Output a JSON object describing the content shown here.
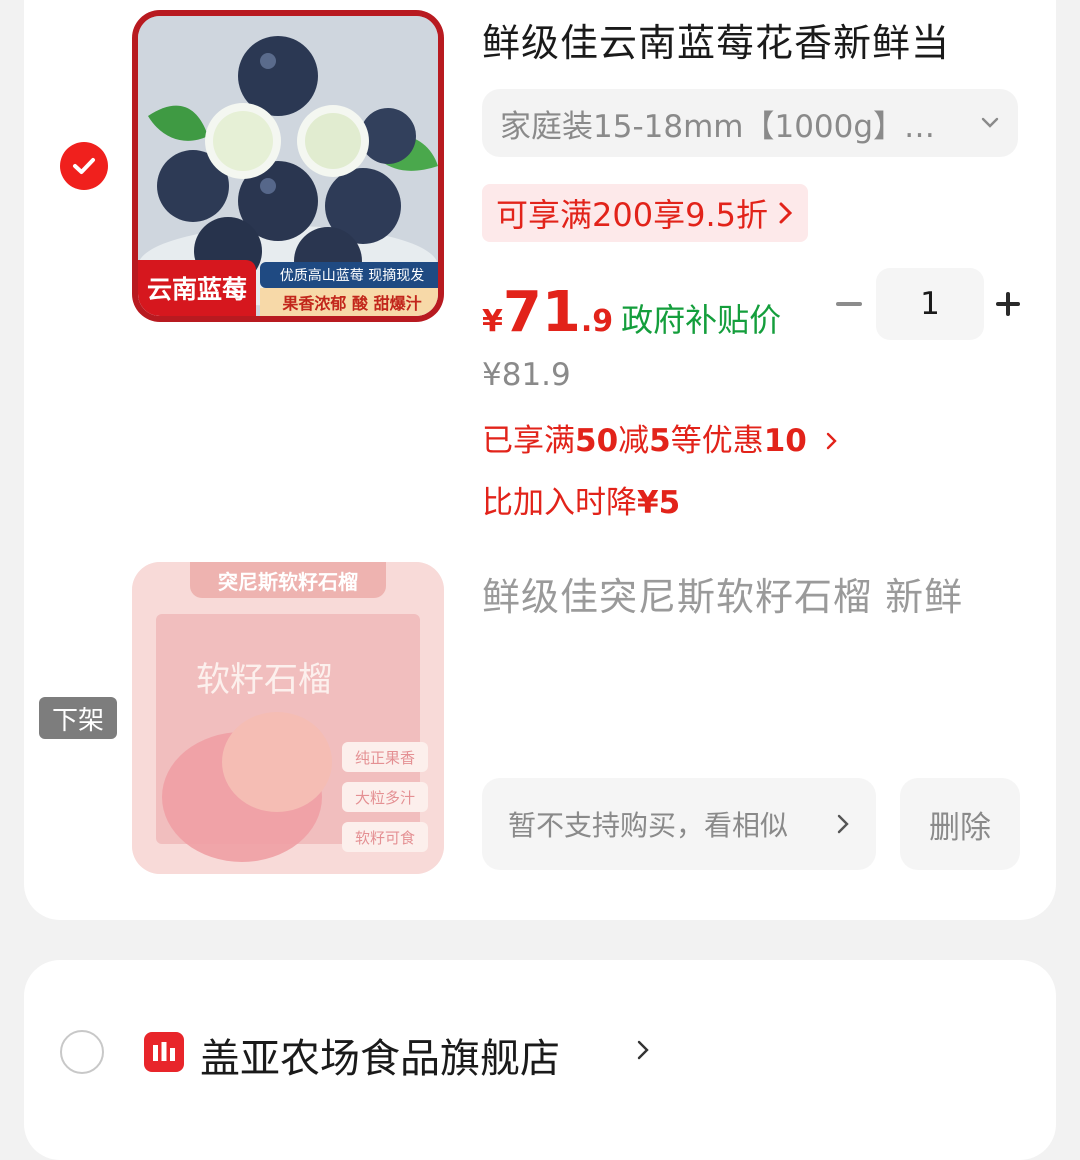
{
  "item1": {
    "title": "鲜级佳云南蓝莓花香新鲜当",
    "sku": "家庭装15-18mm【1000g】…",
    "promo_label": "可享满200享9.5折",
    "price_symbol": "¥",
    "price_int": "71",
    "price_dec": ".9",
    "price_note": "政府补贴价",
    "quantity": "1",
    "original_price": "¥81.9",
    "discount_part1": "已享满",
    "discount_bold1": "50",
    "discount_part2": "减",
    "discount_bold2": "5",
    "discount_part3": "等优惠",
    "discount_bold3": "10",
    "price_drop_prefix": "比加入时降",
    "price_drop_value": "¥5",
    "image": {
      "banner_left": "云南蓝莓",
      "banner_top": "优质高山蓝莓 现摘现发",
      "banner_bottom": "果香浓郁 酸 甜爆汁"
    }
  },
  "item2": {
    "badge": "下架",
    "title": "鲜级佳突尼斯软籽石榴 新鲜",
    "no_buy_label": "暂不支持购买，看相似",
    "delete_label": "删除",
    "image": {
      "ribbon": "突尼斯软籽石榴",
      "box_title": "软籽石榴",
      "tags": [
        "纯正果香",
        "大粒多汁",
        "软籽可食"
      ]
    }
  },
  "shop": {
    "name": "盖亚农场食品旗舰店"
  },
  "colors": {
    "accent_red": "#e2231a",
    "subsidy_green": "#149e3c",
    "promo_bg": "#fde9ea"
  }
}
